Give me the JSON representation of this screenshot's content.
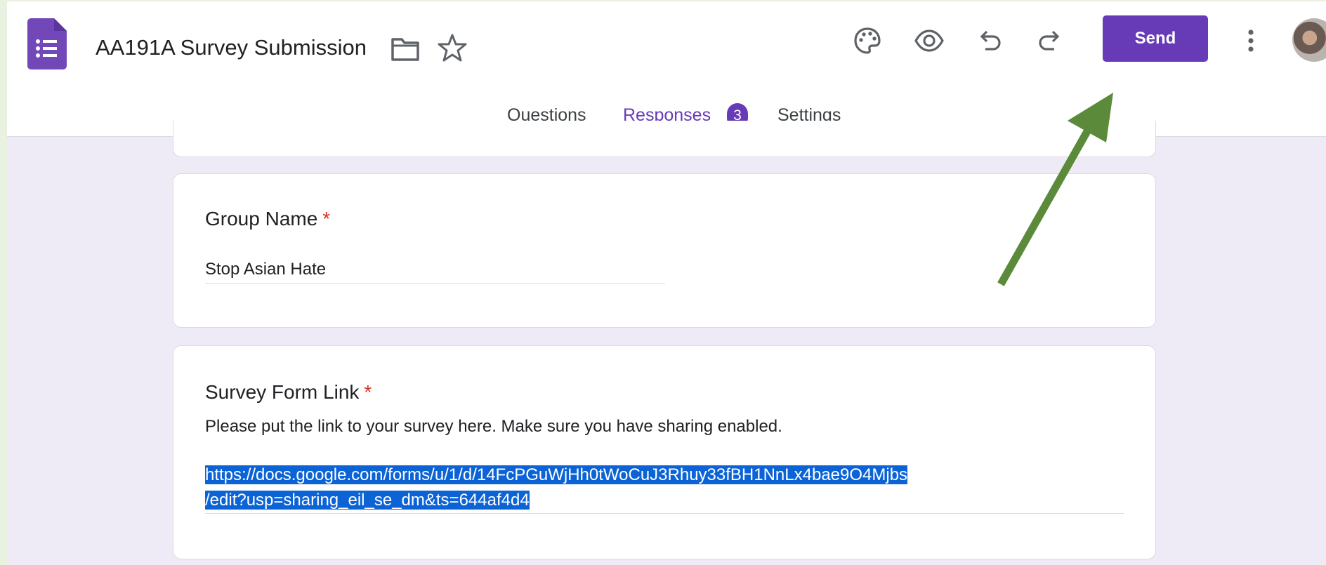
{
  "header": {
    "title": "AA191A Survey Submission",
    "send_label": "Send",
    "icons": [
      "forms-logo-icon",
      "folder-icon",
      "star-icon",
      "palette-icon",
      "eye-icon",
      "undo-icon",
      "redo-icon",
      "more-vert-icon"
    ]
  },
  "tabs": {
    "questions": "Questions",
    "responses": "Responses",
    "responses_count": "3",
    "settings": "Settings"
  },
  "questions": [
    {
      "title": "Group Name",
      "required_mark": "*",
      "answer": "Stop Asian Hate"
    },
    {
      "title": "Survey Form Link",
      "required_mark": "*",
      "description": "Please put the link to your survey here. Make sure you have sharing enabled.",
      "answer_line1": "https://docs.google.com/forms/u/1/d/14FcPGuWjHh0tWoCuJ3Rhuy33fBH1NnLx4bae9O4Mjbs",
      "answer_line2": "/edit?usp=sharing_eil_se_dm&ts=644af4d4"
    }
  ],
  "colors": {
    "accent": "#673ab7",
    "page_background": "#eeebf7",
    "outer_background": "#e9f2e1",
    "selection": "#0b63d6",
    "annotation_arrow": "#5a8a3a",
    "required": "#d93025"
  }
}
